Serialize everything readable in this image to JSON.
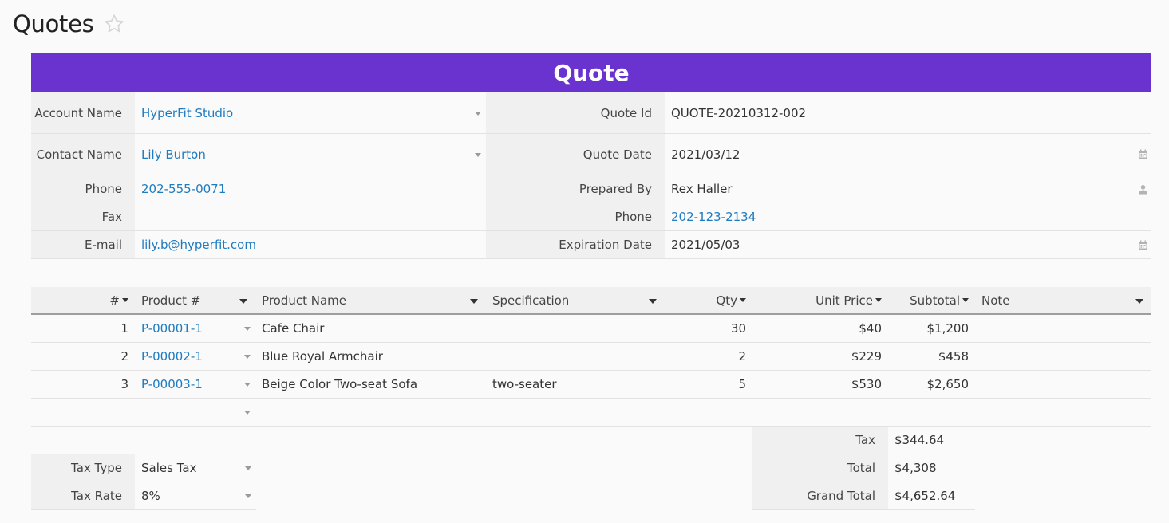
{
  "page": {
    "title": "Quotes"
  },
  "banner": {
    "title": "Quote"
  },
  "customer": {
    "account_name": {
      "label": "Account Name",
      "value": "HyperFit Studio"
    },
    "contact_name": {
      "label": "Contact Name",
      "value": "Lily Burton"
    },
    "phone": {
      "label": "Phone",
      "value": "202-555-0071"
    },
    "fax": {
      "label": "Fax",
      "value": ""
    },
    "email": {
      "label": "E-mail",
      "value": "lily.b@hyperfit.com"
    }
  },
  "quote": {
    "quote_id": {
      "label": "Quote Id",
      "value": "QUOTE-20210312-002"
    },
    "quote_date": {
      "label": "Quote Date",
      "value": "2021/03/12"
    },
    "prepared_by": {
      "label": "Prepared By",
      "value": "Rex Haller"
    },
    "phone": {
      "label": "Phone",
      "value": "202-123-2134"
    },
    "expiration_date": {
      "label": "Expiration Date",
      "value": "2021/05/03"
    }
  },
  "items_table": {
    "columns": [
      "#",
      "Product #",
      "Product Name",
      "Specification",
      "Qty",
      "Unit Price",
      "Subtotal",
      "Note"
    ],
    "rows": [
      {
        "num": "1",
        "product_no": "P-00001-1",
        "product_name": "Cafe Chair",
        "spec": "",
        "qty": "30",
        "unit_price": "$40",
        "subtotal": "$1,200",
        "note": ""
      },
      {
        "num": "2",
        "product_no": "P-00002-1",
        "product_name": "Blue Royal Armchair",
        "spec": "",
        "qty": "2",
        "unit_price": "$229",
        "subtotal": "$458",
        "note": ""
      },
      {
        "num": "3",
        "product_no": "P-00003-1",
        "product_name": "Beige Color Two-seat Sofa",
        "spec": "two-seater",
        "qty": "5",
        "unit_price": "$530",
        "subtotal": "$2,650",
        "note": ""
      }
    ]
  },
  "tax": {
    "tax_type": {
      "label": "Tax Type",
      "value": "Sales Tax"
    },
    "tax_rate": {
      "label": "Tax Rate",
      "value": "8%"
    }
  },
  "totals": {
    "tax": {
      "label": "Tax",
      "value": "$344.64"
    },
    "total": {
      "label": "Total",
      "value": "$4,308"
    },
    "grand_total": {
      "label": "Grand Total",
      "value": "$4,652.64"
    }
  },
  "colors": {
    "banner": "#6a33d0",
    "link": "#1f7bbf",
    "label_bg": "#f0f0f0"
  },
  "icons": [
    "star-icon",
    "calendar-icon",
    "person-icon",
    "dropdown-caret-icon",
    "sort-caret-icon"
  ]
}
